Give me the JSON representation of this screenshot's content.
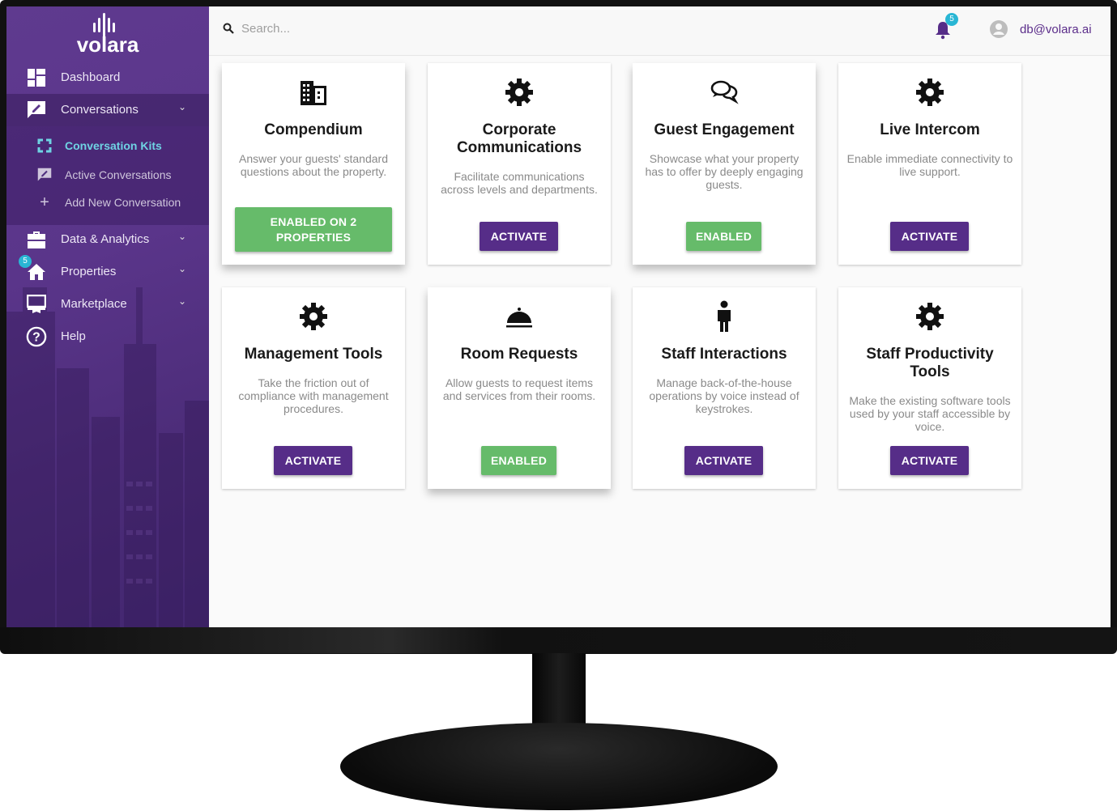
{
  "brand": {
    "name": "volara",
    "accent": "#562d88",
    "success": "#66bb6a",
    "highlight": "#6fd3e3"
  },
  "sidebar": {
    "items": [
      {
        "label": "Dashboard",
        "icon": "dashboard-icon"
      },
      {
        "label": "Conversations",
        "icon": "conversation-icon",
        "expanded": true
      },
      {
        "label": "Data & Analytics",
        "icon": "briefcase-icon"
      },
      {
        "label": "Properties",
        "icon": "home-icon",
        "badge": "5"
      },
      {
        "label": "Marketplace",
        "icon": "marketplace-icon"
      },
      {
        "label": "Help",
        "icon": "help-icon"
      }
    ],
    "conversations_sub": [
      {
        "label": "Conversation Kits",
        "icon": "kits-icon",
        "active": true
      },
      {
        "label": "Active Conversations",
        "icon": "conversation-icon"
      },
      {
        "label": "Add New Conversation",
        "icon": "plus-icon"
      }
    ]
  },
  "topbar": {
    "search_placeholder": "Search...",
    "notification_count": "5",
    "user_email": "db@volara.ai"
  },
  "cards": [
    {
      "title": "Compendium",
      "description": "Answer your guests' standard questions about the property.",
      "icon": "building-icon",
      "button": "ENABLED ON 2 PROPERTIES",
      "status": "enabled"
    },
    {
      "title": "Corporate Communications",
      "description": "Facilitate communications across levels and departments.",
      "icon": "gear-icon",
      "button": "ACTIVATE",
      "status": "inactive"
    },
    {
      "title": "Guest Engagement",
      "description": "Showcase what your property has to offer by deeply engaging guests.",
      "icon": "chat-bubbles-icon",
      "button": "ENABLED",
      "status": "enabled"
    },
    {
      "title": "Live Intercom",
      "description": "Enable immediate connectivity to live support.",
      "icon": "gear-icon",
      "button": "ACTIVATE",
      "status": "inactive"
    },
    {
      "title": "Management Tools",
      "description": "Take the friction out of compliance with management procedures.",
      "icon": "gear-icon",
      "button": "ACTIVATE",
      "status": "inactive"
    },
    {
      "title": "Room Requests",
      "description": "Allow guests to request items and services from their rooms.",
      "icon": "service-bell-icon",
      "button": "ENABLED",
      "status": "enabled"
    },
    {
      "title": "Staff Interactions",
      "description": "Manage back-of-the-house operations by voice instead of keystrokes.",
      "icon": "person-icon",
      "button": "ACTIVATE",
      "status": "inactive"
    },
    {
      "title": "Staff Productivity Tools",
      "description": "Make the existing software tools used by your staff accessible by voice.",
      "icon": "gear-icon",
      "button": "ACTIVATE",
      "status": "inactive"
    }
  ]
}
